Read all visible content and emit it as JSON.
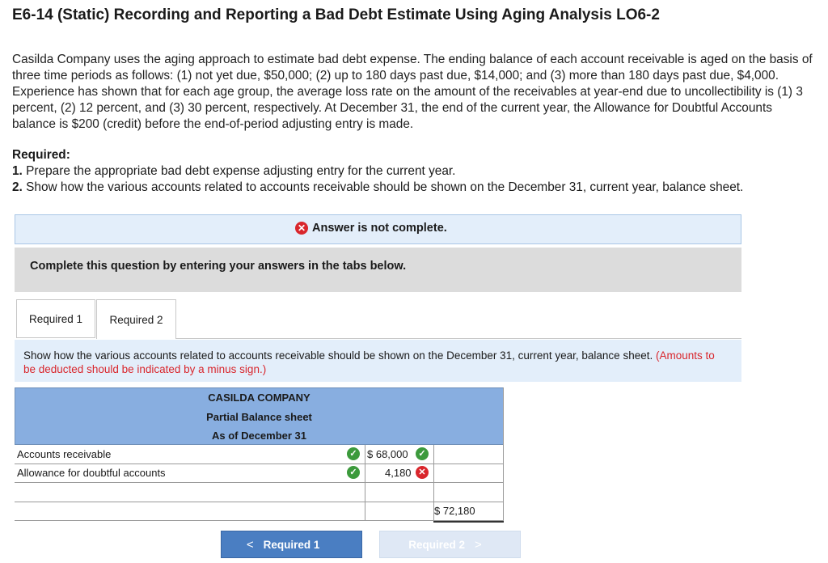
{
  "title": "E6-14 (Static) Recording and Reporting a Bad Debt Estimate Using Aging Analysis LO6-2",
  "problem_text": "Casilda Company uses the aging approach to estimate bad debt expense. The ending balance of each account receivable is aged on the basis of three time periods as follows: (1) not yet due, $50,000; (2) up to 180 days past due, $14,000; and (3) more than 180 days past due, $4,000. Experience has shown that for each age group, the average loss rate on the amount of the receivables at year-end due to uncollectibility is (1) 3 percent, (2) 12 percent, and (3) 30 percent, respectively. At December 31, the end of the current year, the Allowance for Doubtful Accounts balance is $200 (credit) before the end-of-period adjusting entry is made.",
  "required": {
    "heading": "Required:",
    "items": [
      {
        "num": "1.",
        "text": "Prepare the appropriate bad debt expense adjusting entry for the current year."
      },
      {
        "num": "2.",
        "text": "Show how the various accounts related to accounts receivable should be shown on the December 31, current year, balance sheet."
      }
    ]
  },
  "banner": {
    "icon": "x-circle-icon",
    "text": "Answer is not complete."
  },
  "complete_text": "Complete this question by entering your answers in the tabs below.",
  "tabs": [
    {
      "label": "Required 1",
      "active": false
    },
    {
      "label": "Required 2",
      "active": true
    }
  ],
  "instruction": {
    "text": "Show how the various accounts related to accounts receivable should be shown on the December 31, current year, balance sheet.",
    "note": "(Amounts to be deducted should be indicated by a minus sign.)"
  },
  "balance_sheet": {
    "company": "CASILDA COMPANY",
    "statement": "Partial Balance sheet",
    "date": "As of December 31",
    "rows": [
      {
        "label": "Accounts receivable",
        "amount": "$ 68,000",
        "status": "correct"
      },
      {
        "label": "Allowance for doubtful accounts",
        "amount": "4,180",
        "status": "incorrect"
      }
    ],
    "total": "$ 72,180"
  },
  "nav": {
    "prev_label": "Required 1",
    "next_label": "Required 2"
  },
  "colors": {
    "header_blue": "#88aee0",
    "button_blue": "#4a7ec2",
    "error_red": "#d9262c",
    "check_green": "#3c9a3c"
  }
}
